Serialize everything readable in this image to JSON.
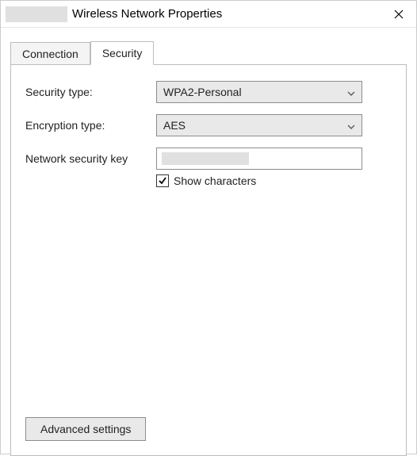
{
  "titlebar": {
    "title": "Wireless Network Properties"
  },
  "tabs": {
    "connection": "Connection",
    "security": "Security"
  },
  "form": {
    "security_type_label": "Security type:",
    "security_type_value": "WPA2-Personal",
    "encryption_type_label": "Encryption type:",
    "encryption_type_value": "AES",
    "network_key_label": "Network security key",
    "show_characters_label": "Show characters",
    "show_characters_checked": true
  },
  "buttons": {
    "advanced": "Advanced settings"
  }
}
